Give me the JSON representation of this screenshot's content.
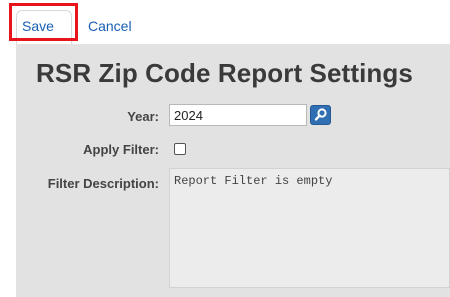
{
  "toolbar": {
    "save_label": "Save",
    "cancel_label": "Cancel"
  },
  "page": {
    "title": "RSR Zip Code Report Settings"
  },
  "form": {
    "year_label": "Year:",
    "year_value": "2024",
    "lookup_icon": "search-icon",
    "apply_filter_label": "Apply Filter:",
    "apply_filter_checked": false,
    "filter_description_label": "Filter Description:",
    "filter_description_value": "Report Filter is empty"
  },
  "colors": {
    "link": "#1a5fb4",
    "highlight": "#e8141b",
    "panel": "#e2e2e2",
    "lookup_button": "#2f6fb2"
  }
}
